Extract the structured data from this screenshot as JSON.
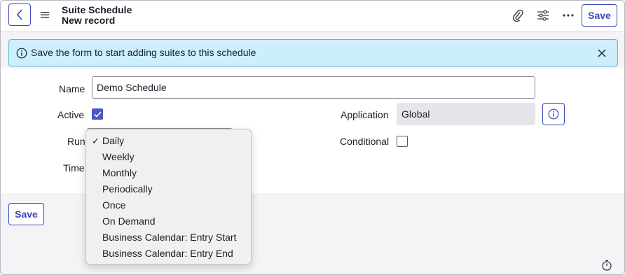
{
  "header": {
    "title": "Suite Schedule",
    "subtitle": "New record",
    "save_label": "Save"
  },
  "banner": {
    "message": "Save the form to start adding suites to this schedule"
  },
  "form": {
    "name_label": "Name",
    "name_value": "Demo Schedule",
    "active_label": "Active",
    "active_checked": true,
    "application_label": "Application",
    "application_value": "Global",
    "run_label": "Run",
    "conditional_label": "Conditional",
    "conditional_checked": false,
    "time_label": "Time"
  },
  "run_dropdown": {
    "selected": "Daily",
    "options": [
      "Daily",
      "Weekly",
      "Monthly",
      "Periodically",
      "Once",
      "On Demand",
      "Business Calendar: Entry Start",
      "Business Calendar: Entry End"
    ]
  },
  "footer": {
    "save_label": "Save"
  },
  "colors": {
    "accent": "#3b49b8",
    "banner_bg": "#cdeefb",
    "banner_border": "#5ab6d9",
    "checkbox_checked": "#4a55c8"
  },
  "icons": [
    "back-icon",
    "menu-icon",
    "attachment-icon",
    "settings-sliders-icon",
    "more-icon",
    "info-icon",
    "close-icon",
    "timer-icon"
  ]
}
